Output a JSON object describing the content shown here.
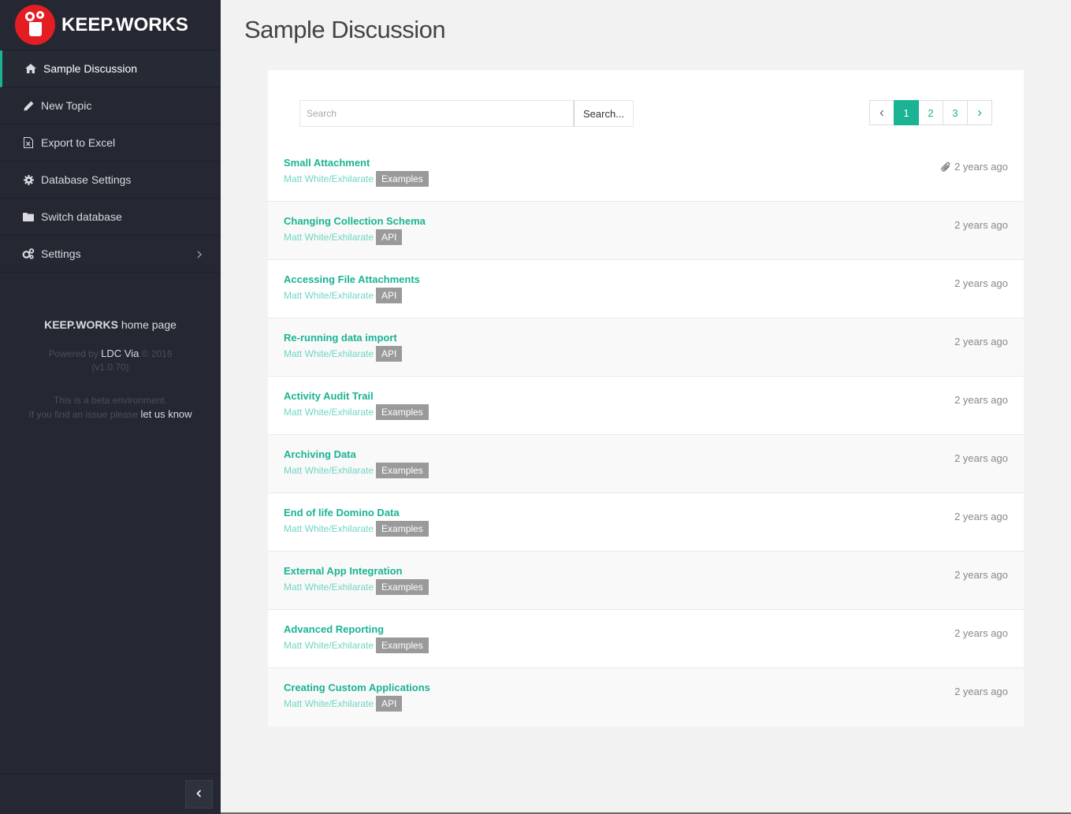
{
  "brand": {
    "name": "KEEP.WORKS"
  },
  "sidebar": {
    "items": [
      {
        "label": "Sample Discussion",
        "icon": "home-icon"
      },
      {
        "label": "New Topic",
        "icon": "pencil-icon"
      },
      {
        "label": "Export to Excel",
        "icon": "excel-file-icon"
      },
      {
        "label": "Database Settings",
        "icon": "gear-icon"
      },
      {
        "label": "Switch database",
        "icon": "folder-icon"
      },
      {
        "label": "Settings",
        "icon": "gears-icon"
      }
    ],
    "footer": {
      "brand": "KEEP.WORKS",
      "home_suffix": " home page",
      "powered_by": "Powered by ",
      "ldc": "LDC Via",
      "copyright": " © 2016",
      "version": "(v1.0.70)",
      "beta_line": "This is a beta environment.",
      "issue_text": "If you find an issue please ",
      "let_us_know": "let us know"
    }
  },
  "page": {
    "title": "Sample Discussion"
  },
  "search": {
    "placeholder": "Search",
    "button": "Search..."
  },
  "pagination": {
    "prev": "‹",
    "pages": [
      "1",
      "2",
      "3"
    ],
    "next": "›",
    "active": "1"
  },
  "topics": [
    {
      "title": "Small Attachment",
      "author": "Matt White/Exhilarate",
      "tag": "Examples",
      "time": "2 years ago",
      "attachment": true
    },
    {
      "title": "Changing Collection Schema",
      "author": "Matt White/Exhilarate",
      "tag": "API",
      "time": "2 years ago"
    },
    {
      "title": "Accessing File Attachments",
      "author": "Matt White/Exhilarate",
      "tag": "API",
      "time": "2 years ago"
    },
    {
      "title": "Re-running data import",
      "author": "Matt White/Exhilarate",
      "tag": "API",
      "time": "2 years ago"
    },
    {
      "title": "Activity Audit Trail",
      "author": "Matt White/Exhilarate",
      "tag": "Examples",
      "time": "2 years ago"
    },
    {
      "title": "Archiving Data",
      "author": "Matt White/Exhilarate",
      "tag": "Examples",
      "time": "2 years ago"
    },
    {
      "title": "End of life Domino Data",
      "author": "Matt White/Exhilarate",
      "tag": "Examples",
      "time": "2 years ago"
    },
    {
      "title": "External App Integration",
      "author": "Matt White/Exhilarate",
      "tag": "Examples",
      "time": "2 years ago"
    },
    {
      "title": "Advanced Reporting",
      "author": "Matt White/Exhilarate",
      "tag": "Examples",
      "time": "2 years ago"
    },
    {
      "title": "Creating Custom Applications",
      "author": "Matt White/Exhilarate",
      "tag": "API",
      "time": "2 years ago"
    }
  ],
  "colors": {
    "accent": "#1ab394",
    "sidebar": "#252832",
    "brand_red": "#e41d23",
    "tag": "#9a9a9a"
  }
}
